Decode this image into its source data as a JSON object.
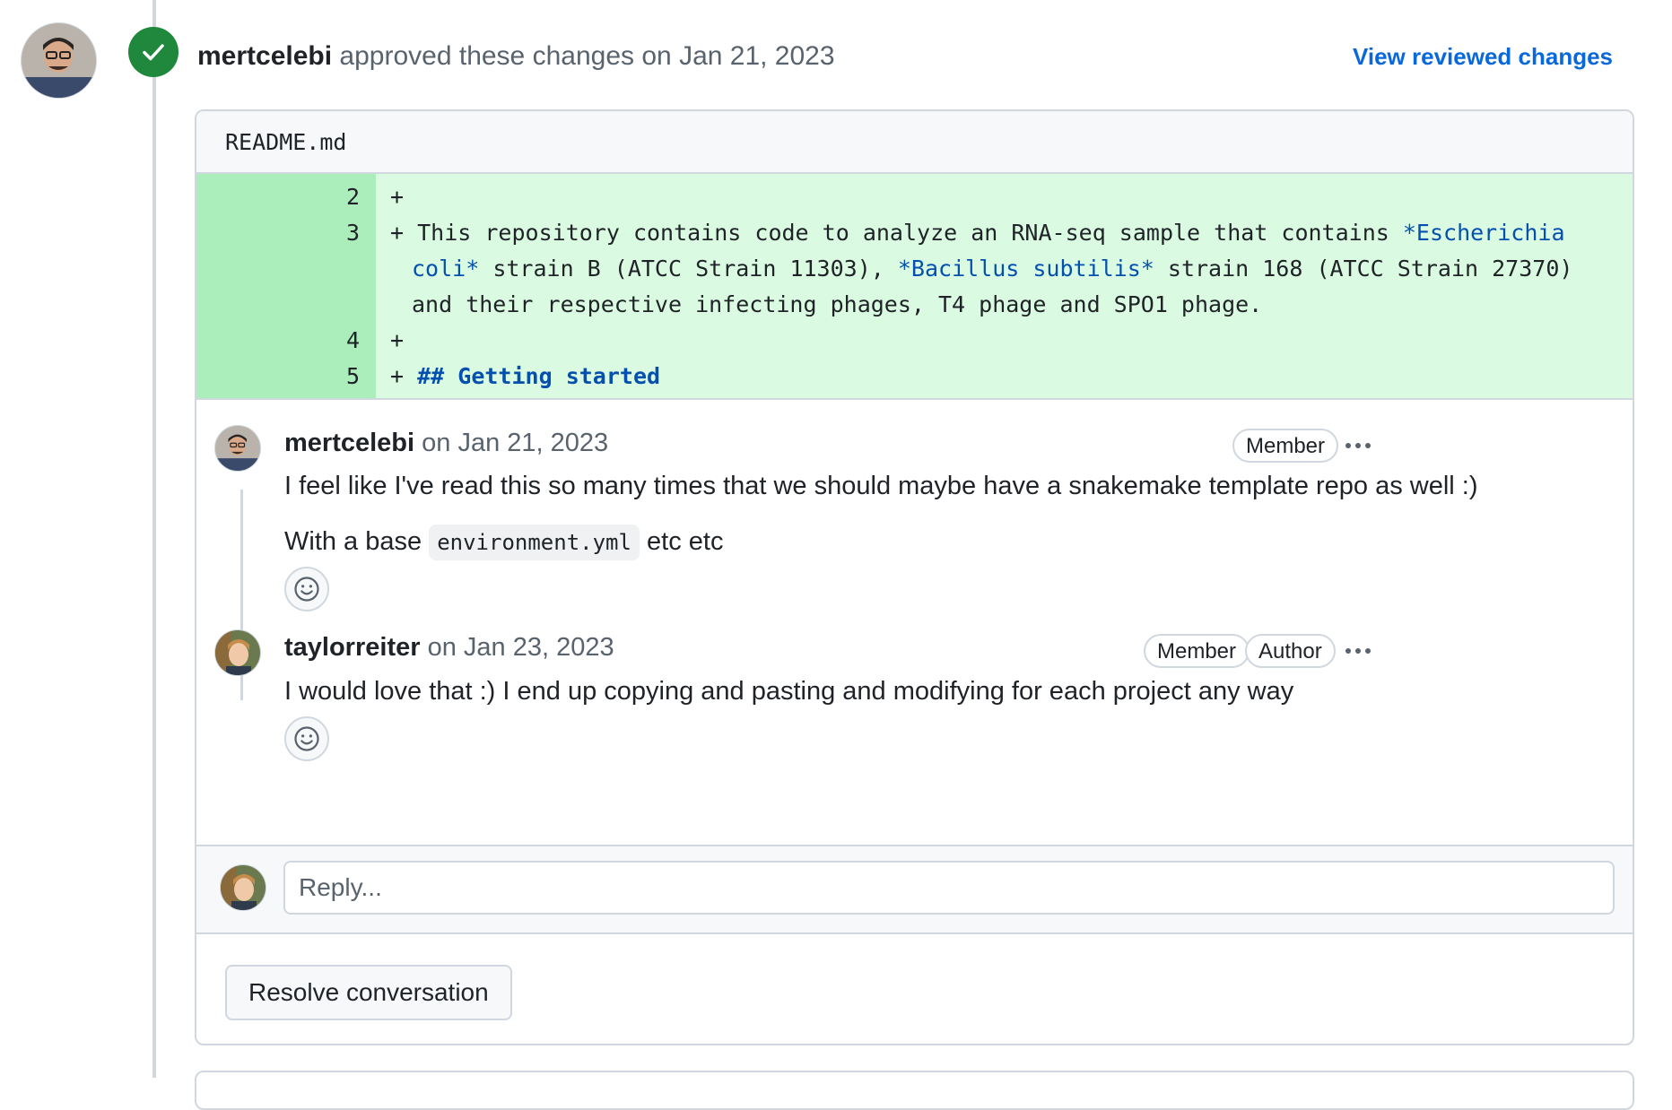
{
  "review": {
    "author": "mertcelebi",
    "action": "approved these changes",
    "date_text": "on Jan 21, 2023",
    "view_changes_label": "View reviewed changes"
  },
  "file": {
    "name": "README.md",
    "lines": [
      {
        "num": "2",
        "sign": "+",
        "segments": [
          {
            "text": "",
            "style": "plain"
          }
        ]
      },
      {
        "num": "3",
        "sign": "+",
        "segments": [
          {
            "text": "This repository contains code to analyze an RNA-seq sample that contains ",
            "style": "plain"
          },
          {
            "text": "*Escherichia coli*",
            "style": "em"
          },
          {
            "text": " strain B (ATCC Strain 11303), ",
            "style": "plain"
          },
          {
            "text": "*Bacillus subtilis*",
            "style": "em"
          },
          {
            "text": " strain 168 (ATCC Strain 27370) and their respective infecting phages, T4 phage and SPO1 phage.",
            "style": "plain"
          }
        ]
      },
      {
        "num": "4",
        "sign": "+",
        "segments": [
          {
            "text": "",
            "style": "plain"
          }
        ]
      },
      {
        "num": "5",
        "sign": "+",
        "segments": [
          {
            "text": "## Getting started",
            "style": "heading"
          }
        ]
      }
    ]
  },
  "comments": [
    {
      "author": "mertcelebi",
      "date_text": "on Jan 21, 2023",
      "badges": [
        "Member"
      ],
      "body_line1": "I feel like I've read this so many times that we should maybe have a snakemake template repo as well :)",
      "body_line2_prefix": "With a base",
      "body_line2_code": "environment.yml",
      "body_line2_suffix": "etc etc"
    },
    {
      "author": "taylorreiter",
      "date_text": "on Jan 23, 2023",
      "badges": [
        "Member",
        "Author"
      ],
      "body_line1": "I would love that :) I end up copying and pasting and modifying for each project any way"
    }
  ],
  "reply": {
    "placeholder": "Reply..."
  },
  "resolve_label": "Resolve conversation",
  "colors": {
    "approved": "#1f883d",
    "link": "#0969da",
    "diff_add_bg": "#dafbe1",
    "diff_add_num_bg": "#aceebb",
    "md_syntax": "#0550ae"
  },
  "icons": [
    "check-icon",
    "smiley-icon",
    "kebab-icon"
  ]
}
